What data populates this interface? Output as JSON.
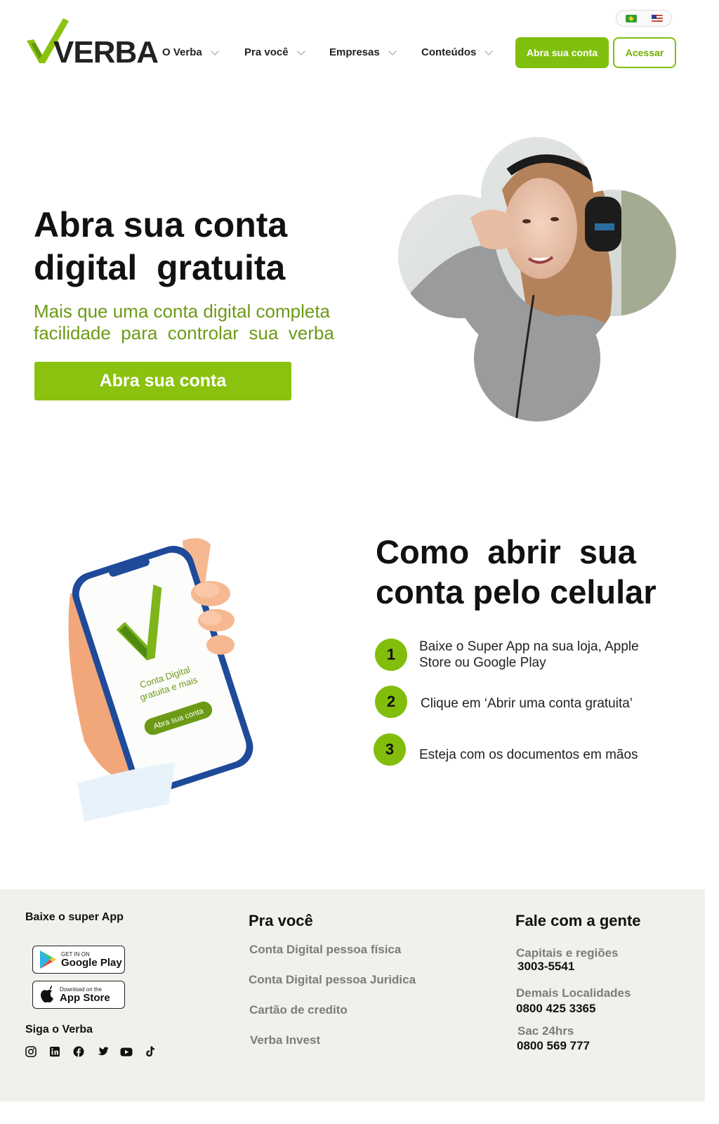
{
  "header": {
    "logo_text": "VERBA",
    "nav": [
      {
        "label": "O Verba"
      },
      {
        "label": "Pra você"
      },
      {
        "label": "Empresas"
      },
      {
        "label": "Conteúdos"
      }
    ],
    "open_account_button": "Abra sua conta",
    "login_button": "Acessar",
    "languages": [
      "pt-BR flag",
      "en-US flag"
    ]
  },
  "hero": {
    "title_line1": "Abra sua conta",
    "title_line2": "digital  gratuita",
    "subtitle_line1": "Mais que uma conta digital completa",
    "subtitle_line2": "facilidade  para  controlar  sua  verba",
    "cta": "Abra sua conta"
  },
  "phone_mockup": {
    "screen_text_line1": "Conta Digital",
    "screen_text_line2": "gratuita e mais",
    "screen_button": "Abra sua conta"
  },
  "how_to": {
    "title_line1": "Como  abrir  sua",
    "title_line2": "conta pelo celular",
    "steps": [
      {
        "number": "1",
        "line1": "Baixe o Super App na sua loja, Apple",
        "line2": "Store ou Google Play"
      },
      {
        "number": "2",
        "line1": "Clique em ‘Abrir uma conta gratuita’",
        "line2": ""
      },
      {
        "number": "3",
        "line1": "Esteja com os documentos em mãos",
        "line2": ""
      }
    ]
  },
  "footer": {
    "app_heading": "Baixe o super App",
    "google_play": {
      "small": "GET IN ON",
      "big": "Google Play"
    },
    "app_store": {
      "small": "Download on the",
      "big": "App Store"
    },
    "follow_heading": "Siga o Verba",
    "social_icons": [
      "instagram-icon",
      "linkedin-icon",
      "facebook-icon",
      "twitter-icon",
      "youtube-icon",
      "tiktok-icon"
    ],
    "pra_voce_heading": "Pra você",
    "pra_voce_links": [
      "Conta Digital pessoa física",
      "Conta Digital pessoa Juridica",
      "Cartão de credito",
      "Verba Invest"
    ],
    "contact_heading": "Fale com a gente",
    "contacts": [
      {
        "label": "Capitais e regiões",
        "phone": "3003-5541"
      },
      {
        "label": "Demais Localidades",
        "phone": "0800 425 3365"
      },
      {
        "label": "Sac 24hrs",
        "phone": "0800 569 777"
      }
    ]
  },
  "colors": {
    "brand_green": "#8ac20f",
    "brand_green_dark": "#6d9a16",
    "footer_bg": "#f0f0ec"
  }
}
